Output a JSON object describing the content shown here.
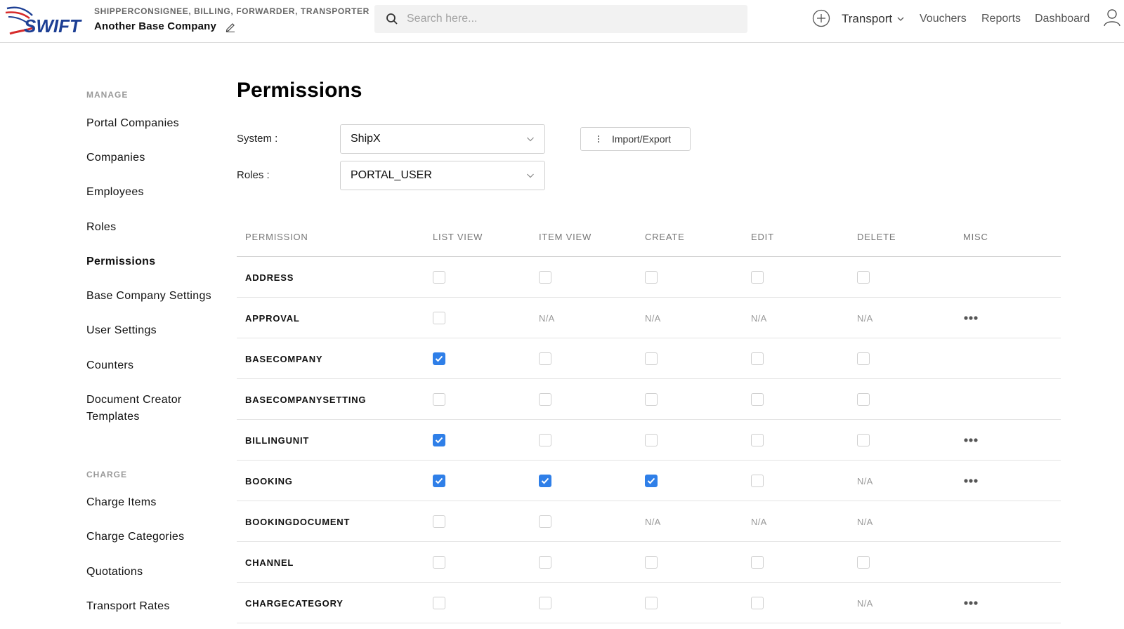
{
  "header": {
    "logo_text": "SWIFT",
    "company_roles": "SHIPPERCONSIGNEE, BILLING, FORWARDER, TRANSPORTER",
    "company_name": "Another Base Company",
    "search_placeholder": "Search here...",
    "nav": {
      "transport": "Transport",
      "vouchers": "Vouchers",
      "reports": "Reports",
      "dashboard": "Dashboard"
    }
  },
  "sidebar": {
    "manage_title": "MANAGE",
    "manage_items": [
      "Portal Companies",
      "Companies",
      "Employees",
      "Roles",
      "Permissions",
      "Base Company Settings",
      "User Settings",
      "Counters",
      "Document Creator Templates"
    ],
    "active_item": "Permissions",
    "charge_title": "CHARGE",
    "charge_items": [
      "Charge Items",
      "Charge Categories",
      "Quotations",
      "Transport Rates"
    ]
  },
  "main": {
    "title": "Permissions",
    "system_label": "System :",
    "system_value": "ShipX",
    "roles_label": "Roles :",
    "roles_value": "PORTAL_USER",
    "import_export_label": "Import/Export"
  },
  "table": {
    "headers": [
      "PERMISSION",
      "LIST VIEW",
      "ITEM VIEW",
      "CREATE",
      "EDIT",
      "DELETE",
      "MISC"
    ],
    "na_text": "N/A",
    "rows": [
      {
        "name": "ADDRESS",
        "cells": [
          "off",
          "off",
          "off",
          "off",
          "off"
        ],
        "misc": false
      },
      {
        "name": "APPROVAL",
        "cells": [
          "off",
          "na",
          "na",
          "na",
          "na"
        ],
        "misc": true
      },
      {
        "name": "BASECOMPANY",
        "cells": [
          "on",
          "off",
          "off",
          "off",
          "off"
        ],
        "misc": false
      },
      {
        "name": "BASECOMPANYSETTING",
        "cells": [
          "off",
          "off",
          "off",
          "off",
          "off"
        ],
        "misc": false
      },
      {
        "name": "BILLINGUNIT",
        "cells": [
          "on",
          "off",
          "off",
          "off",
          "off"
        ],
        "misc": true
      },
      {
        "name": "BOOKING",
        "cells": [
          "on",
          "on",
          "on",
          "off",
          "na"
        ],
        "misc": true
      },
      {
        "name": "BOOKINGDOCUMENT",
        "cells": [
          "off",
          "off",
          "na",
          "na",
          "na"
        ],
        "misc": false
      },
      {
        "name": "CHANNEL",
        "cells": [
          "off",
          "off",
          "off",
          "off",
          "off"
        ],
        "misc": false
      },
      {
        "name": "CHARGECATEGORY",
        "cells": [
          "off",
          "off",
          "off",
          "off",
          "na"
        ],
        "misc": true
      }
    ]
  },
  "colors": {
    "accent": "#2f7fe8",
    "logo_red": "#d62a2a",
    "logo_blue": "#1d3f94"
  },
  "icons": {
    "search": "search-icon",
    "edit": "pencil-icon",
    "add": "plus-circle-icon",
    "user": "user-icon",
    "chevron": "chevron-down-icon",
    "misc": "ellipsis-icon",
    "import": "vertical-ellipsis-icon"
  }
}
